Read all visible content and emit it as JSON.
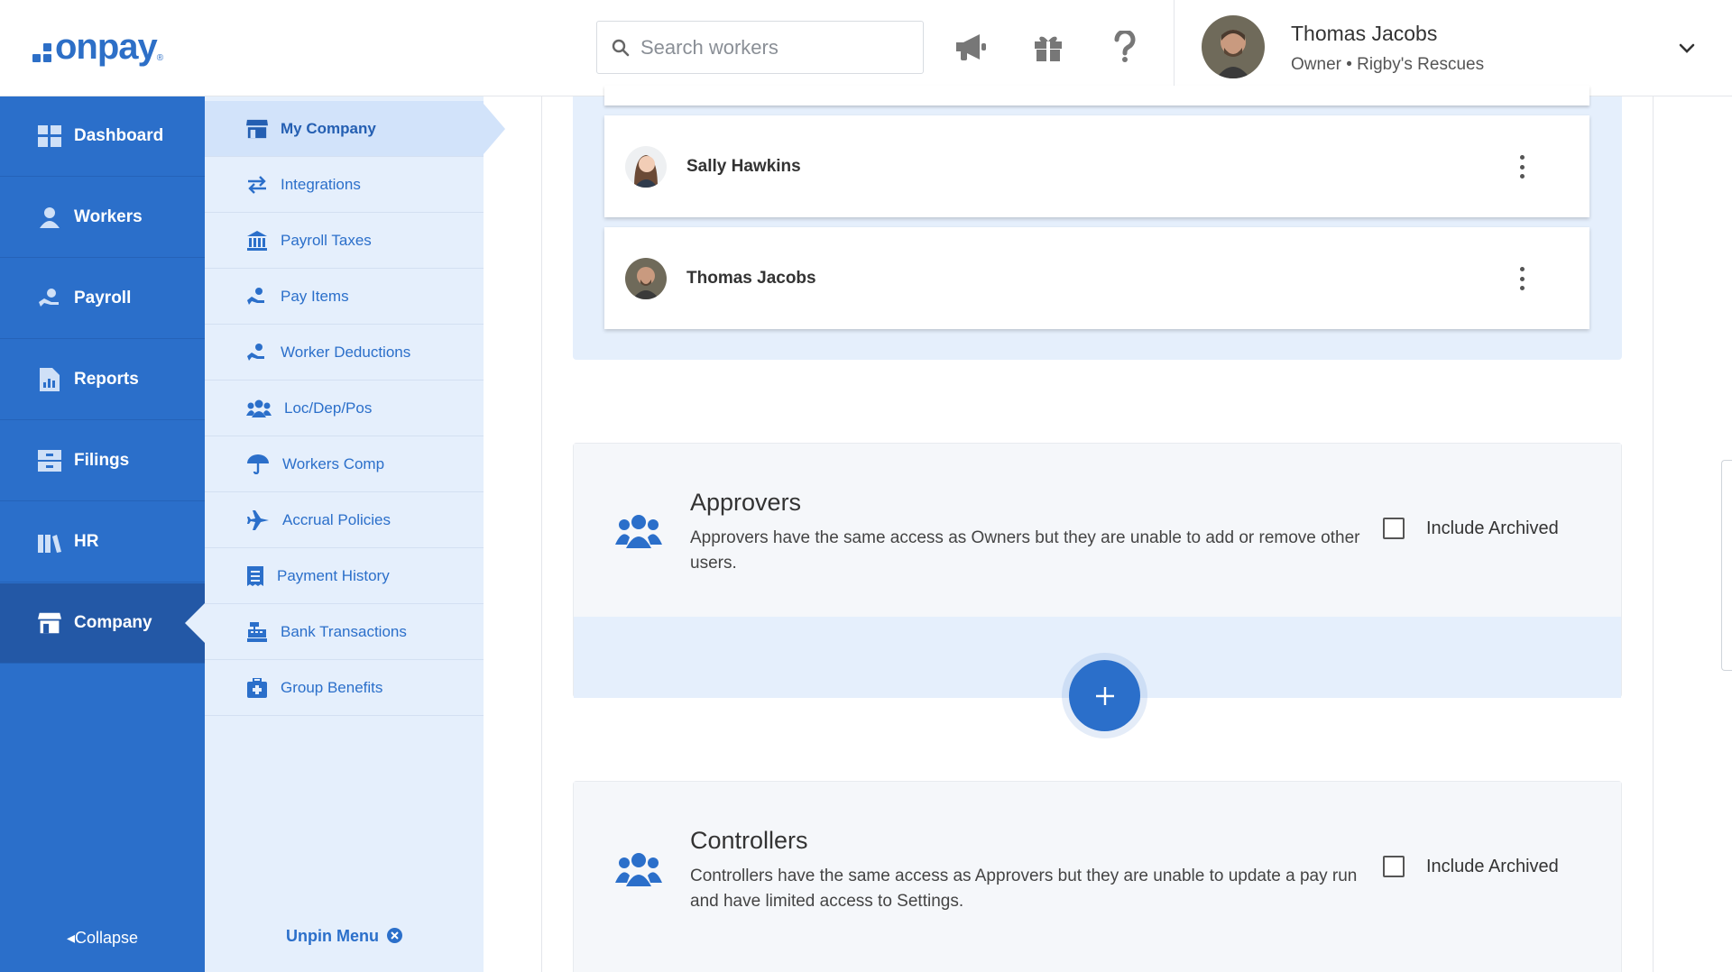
{
  "app": {
    "logo_text": "onpay",
    "logo_mark": "®"
  },
  "header": {
    "search_placeholder": "Search workers",
    "user": {
      "name": "Thomas Jacobs",
      "role": "Owner • Rigby's Rescues"
    }
  },
  "sidebar": {
    "items": [
      {
        "label": "Dashboard",
        "icon": "dashboard-icon"
      },
      {
        "label": "Workers",
        "icon": "workers-icon"
      },
      {
        "label": "Payroll",
        "icon": "payroll-icon"
      },
      {
        "label": "Reports",
        "icon": "reports-icon"
      },
      {
        "label": "Filings",
        "icon": "filings-icon"
      },
      {
        "label": "HR",
        "icon": "hr-icon"
      },
      {
        "label": "Company",
        "icon": "company-icon"
      }
    ],
    "active": "Company",
    "collapse_label": "Collapse"
  },
  "submenu": {
    "items": [
      {
        "label": "My Company",
        "icon": "store-icon"
      },
      {
        "label": "Integrations",
        "icon": "arrows-icon"
      },
      {
        "label": "Payroll Taxes",
        "icon": "bank-icon"
      },
      {
        "label": "Pay Items",
        "icon": "hand-coin-icon"
      },
      {
        "label": "Worker Deductions",
        "icon": "hand-coin-icon"
      },
      {
        "label": "Loc/Dep/Pos",
        "icon": "users-icon"
      },
      {
        "label": "Workers Comp",
        "icon": "umbrella-icon"
      },
      {
        "label": "Accrual Policies",
        "icon": "plane-icon"
      },
      {
        "label": "Payment History",
        "icon": "receipt-icon"
      },
      {
        "label": "Bank Transactions",
        "icon": "cash-register-icon"
      },
      {
        "label": "Group Benefits",
        "icon": "medical-kit-icon"
      }
    ],
    "active": "My Company",
    "unpin_label": "Unpin Menu"
  },
  "owners": [
    {
      "name": "Sally Hawkins"
    },
    {
      "name": "Thomas Jacobs"
    }
  ],
  "roles": [
    {
      "title": "Approvers",
      "description": "Approvers have the same access as Owners but they are unable to add or remove other users.",
      "checkbox_label": "Include Archived"
    },
    {
      "title": "Controllers",
      "description": "Controllers have the same access as Approvers but they are unable to update a pay run and have limited access to Settings.",
      "checkbox_label": "Include Archived"
    }
  ],
  "colors": {
    "brand": "#2b6fca",
    "sidebar_active": "#2358a6",
    "submenu_bg": "#e5effc"
  }
}
